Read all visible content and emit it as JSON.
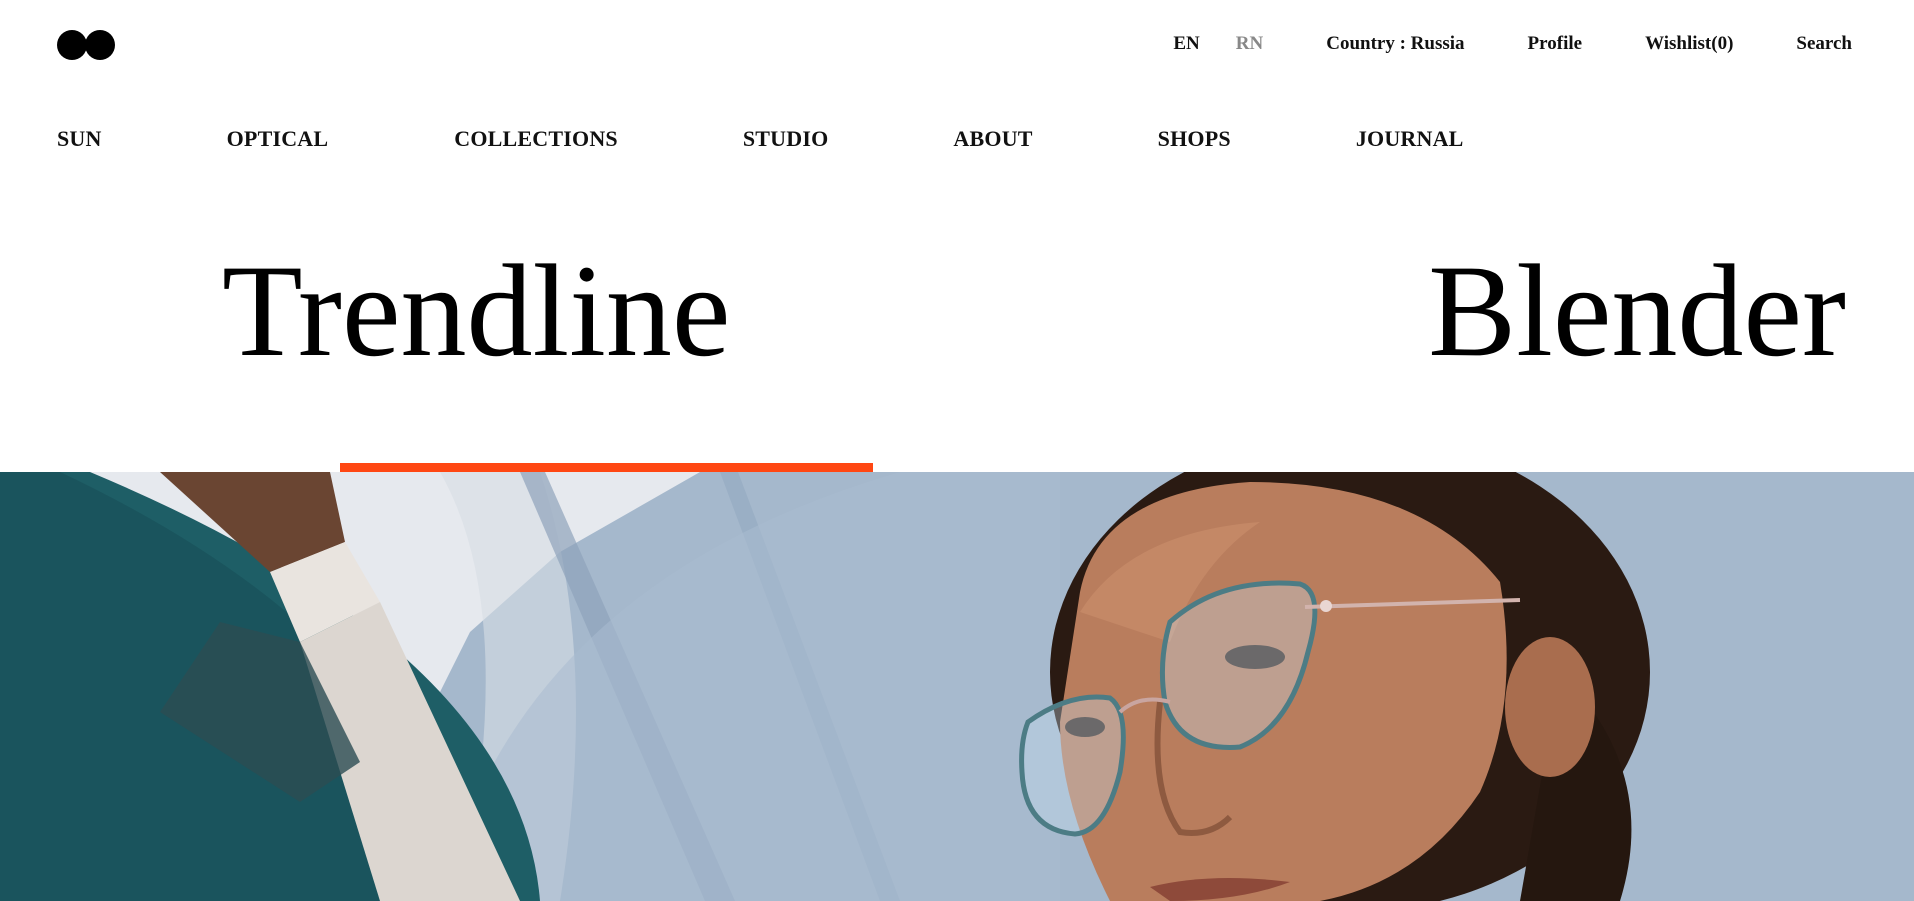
{
  "header": {
    "logo": {
      "icon": "two-dots-logo-icon"
    },
    "utility": {
      "lang_en": "EN",
      "lang_rn": "RN",
      "country": "Country : Russia",
      "profile": "Profile",
      "wishlist": "Wishlist(0)",
      "search": "Search"
    },
    "nav": [
      "SUN",
      "OPTICAL",
      "COLLECTIONS",
      "STUDIO",
      "ABOUT",
      "SHOPS",
      "JOURNAL"
    ]
  },
  "collections": {
    "items": [
      "Trendline",
      "Blender"
    ],
    "active_index": 0
  },
  "colors": {
    "accent": "#ff4713",
    "text": "#111111",
    "muted": "#888888",
    "sky": "#a7bbcf",
    "teal": "#1e5e66"
  }
}
